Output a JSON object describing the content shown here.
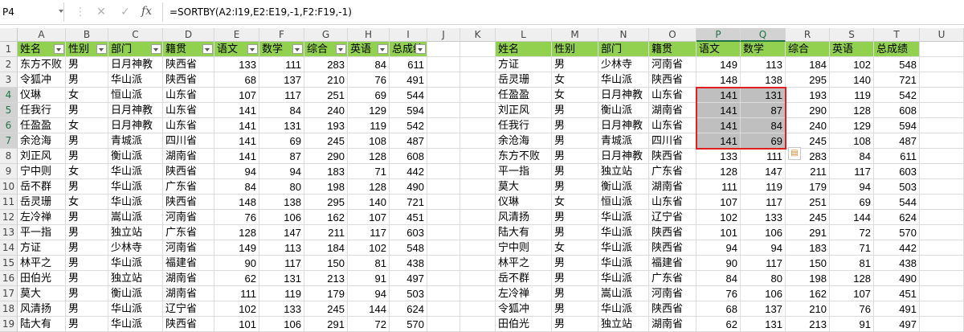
{
  "namebox": "P4",
  "formula_bar": {
    "cancel": "✕",
    "confirm": "✓",
    "fx": "fx",
    "formula": "=SORTBY(A2:I19,E2:E19,-1,F2:F19,-1)"
  },
  "columns": [
    "A",
    "B",
    "C",
    "D",
    "E",
    "F",
    "G",
    "H",
    "I",
    "J",
    "K",
    "L",
    "M",
    "N",
    "O",
    "P",
    "Q",
    "R",
    "S",
    "T",
    "U"
  ],
  "rows": [
    "1",
    "2",
    "3",
    "4",
    "5",
    "6",
    "7",
    "8",
    "9",
    "10",
    "11",
    "12",
    "13",
    "14",
    "15",
    "16",
    "17",
    "18",
    "19"
  ],
  "left_table": {
    "headers": [
      "姓名",
      "性别",
      "部门",
      "籍贯",
      "语文",
      "数学",
      "综合",
      "英语",
      "总成绩"
    ],
    "rows": [
      [
        "东方不败",
        "男",
        "日月神教",
        "陕西省",
        "133",
        "111",
        "283",
        "84",
        "611"
      ],
      [
        "令狐冲",
        "男",
        "华山派",
        "陕西省",
        "68",
        "137",
        "210",
        "76",
        "491"
      ],
      [
        "仪琳",
        "女",
        "恒山派",
        "山东省",
        "107",
        "117",
        "251",
        "69",
        "544"
      ],
      [
        "任我行",
        "男",
        "日月神教",
        "山东省",
        "141",
        "84",
        "240",
        "129",
        "594"
      ],
      [
        "任盈盈",
        "女",
        "日月神教",
        "山东省",
        "141",
        "131",
        "193",
        "119",
        "542"
      ],
      [
        "余沧海",
        "男",
        "青城派",
        "四川省",
        "141",
        "69",
        "245",
        "108",
        "487"
      ],
      [
        "刘正风",
        "男",
        "衡山派",
        "湖南省",
        "141",
        "87",
        "290",
        "128",
        "608"
      ],
      [
        "宁中则",
        "女",
        "华山派",
        "陕西省",
        "94",
        "94",
        "183",
        "71",
        "442"
      ],
      [
        "岳不群",
        "男",
        "华山派",
        "广东省",
        "84",
        "80",
        "198",
        "128",
        "490"
      ],
      [
        "岳灵珊",
        "女",
        "华山派",
        "陕西省",
        "148",
        "138",
        "295",
        "140",
        "721"
      ],
      [
        "左冷禅",
        "男",
        "嵩山派",
        "河南省",
        "76",
        "106",
        "162",
        "107",
        "451"
      ],
      [
        "平一指",
        "男",
        "独立站",
        "广东省",
        "128",
        "147",
        "211",
        "117",
        "603"
      ],
      [
        "方证",
        "男",
        "少林寺",
        "河南省",
        "149",
        "113",
        "184",
        "102",
        "548"
      ],
      [
        "林平之",
        "男",
        "华山派",
        "福建省",
        "90",
        "117",
        "150",
        "81",
        "438"
      ],
      [
        "田伯光",
        "男",
        "独立站",
        "湖南省",
        "62",
        "131",
        "213",
        "91",
        "497"
      ],
      [
        "莫大",
        "男",
        "衡山派",
        "湖南省",
        "111",
        "119",
        "179",
        "94",
        "503"
      ],
      [
        "风清扬",
        "男",
        "华山派",
        "辽宁省",
        "102",
        "133",
        "245",
        "144",
        "624"
      ],
      [
        "陆大有",
        "男",
        "华山派",
        "陕西省",
        "101",
        "106",
        "291",
        "72",
        "570"
      ]
    ]
  },
  "right_table": {
    "headers": [
      "姓名",
      "性别",
      "部门",
      "籍贯",
      "语文",
      "数学",
      "综合",
      "英语",
      "总成绩"
    ],
    "rows": [
      [
        "方证",
        "男",
        "少林寺",
        "河南省",
        "149",
        "113",
        "184",
        "102",
        "548"
      ],
      [
        "岳灵珊",
        "女",
        "华山派",
        "陕西省",
        "148",
        "138",
        "295",
        "140",
        "721"
      ],
      [
        "任盈盈",
        "女",
        "日月神教",
        "山东省",
        "141",
        "131",
        "193",
        "119",
        "542"
      ],
      [
        "刘正风",
        "男",
        "衡山派",
        "湖南省",
        "141",
        "87",
        "290",
        "128",
        "608"
      ],
      [
        "任我行",
        "男",
        "日月神教",
        "山东省",
        "141",
        "84",
        "240",
        "129",
        "594"
      ],
      [
        "余沧海",
        "男",
        "青城派",
        "四川省",
        "141",
        "69",
        "245",
        "108",
        "487"
      ],
      [
        "东方不败",
        "男",
        "日月神教",
        "陕西省",
        "133",
        "111",
        "283",
        "84",
        "611"
      ],
      [
        "平一指",
        "男",
        "独立站",
        "广东省",
        "128",
        "147",
        "211",
        "117",
        "603"
      ],
      [
        "莫大",
        "男",
        "衡山派",
        "湖南省",
        "111",
        "119",
        "179",
        "94",
        "503"
      ],
      [
        "仪琳",
        "女",
        "恒山派",
        "山东省",
        "107",
        "117",
        "251",
        "69",
        "544"
      ],
      [
        "风清扬",
        "男",
        "华山派",
        "辽宁省",
        "102",
        "133",
        "245",
        "144",
        "624"
      ],
      [
        "陆大有",
        "男",
        "华山派",
        "陕西省",
        "101",
        "106",
        "291",
        "72",
        "570"
      ],
      [
        "宁中则",
        "女",
        "华山派",
        "陕西省",
        "94",
        "94",
        "183",
        "71",
        "442"
      ],
      [
        "林平之",
        "男",
        "华山派",
        "福建省",
        "90",
        "117",
        "150",
        "81",
        "438"
      ],
      [
        "岳不群",
        "男",
        "华山派",
        "广东省",
        "84",
        "80",
        "198",
        "128",
        "490"
      ],
      [
        "左冷禅",
        "男",
        "嵩山派",
        "河南省",
        "76",
        "106",
        "162",
        "107",
        "451"
      ],
      [
        "令狐冲",
        "男",
        "华山派",
        "陕西省",
        "68",
        "137",
        "210",
        "76",
        "491"
      ],
      [
        "田伯光",
        "男",
        "独立站",
        "湖南省",
        "62",
        "131",
        "213",
        "91",
        "497"
      ]
    ]
  },
  "colors": {
    "header_fill": "#92d050",
    "highlight_fill": "#bfbfbf",
    "selection_border": "#e02020",
    "active_header": "#217346"
  }
}
